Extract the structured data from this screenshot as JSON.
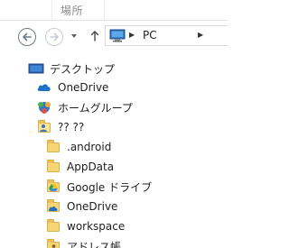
{
  "ribbon": {
    "tab_label": "場所"
  },
  "navigation": {
    "back_label": "←",
    "forward_label": "→",
    "up_label": "↑",
    "address": {
      "separator": "▶",
      "location": "PC"
    }
  },
  "tree": {
    "items": [
      {
        "label": "デスクトップ",
        "icon": "desktop-icon"
      },
      {
        "label": "OneDrive",
        "icon": "cloud-icon"
      },
      {
        "label": "ホームグループ",
        "icon": "homegroup-icon"
      },
      {
        "label": "?? ??",
        "icon": "user-folder-icon"
      },
      {
        "label": ".android",
        "icon": "folder-icon"
      },
      {
        "label": "AppData",
        "icon": "folder-icon"
      },
      {
        "label": "Google ドライブ",
        "icon": "google-drive-folder-icon"
      },
      {
        "label": "OneDrive",
        "icon": "onedrive-folder-icon"
      },
      {
        "label": "workspace",
        "icon": "folder-icon"
      },
      {
        "label": "アドレス帳",
        "icon": "contacts-folder-icon"
      }
    ]
  },
  "colors": {
    "cloud_blue": "#1f6fc6",
    "folder_yellow": "#f6d577",
    "nav_gray": "#6f7a87"
  }
}
